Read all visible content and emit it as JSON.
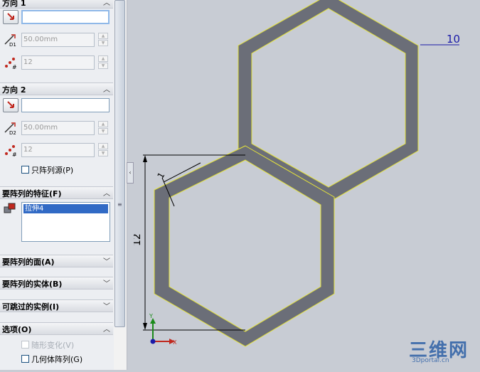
{
  "direction1": {
    "title": "方向 1",
    "spacing_value": "50.00mm",
    "count_value": "12"
  },
  "direction2": {
    "title": "方向 2",
    "spacing_value": "50.00mm",
    "count_value": "12",
    "pattern_seed_only_label": "只阵列源(P)"
  },
  "features_group": {
    "title": "要阵列的特征(F)",
    "items": [
      "拉伸4"
    ]
  },
  "faces_group": {
    "title": "要阵列的面(A)"
  },
  "bodies_group": {
    "title": "要阵列的实体(B)"
  },
  "skip_group": {
    "title": "可跳过的实例(I)"
  },
  "options_group": {
    "title": "选项(O)",
    "vary_sketch_label": "随形变化(V)",
    "geometry_pattern_label": "几何体阵列(G)"
  },
  "dimensions": {
    "offset": "10",
    "height": "12",
    "thickness": "1"
  },
  "triad": {
    "y": "Y",
    "x": "X"
  },
  "watermark": {
    "title": "三维网",
    "sub": "3Dportal.cn"
  },
  "colors": {
    "hex_fill": "#6b6e78",
    "hex_edge": "#e6e43a",
    "dim_color": "#1a1aa8",
    "background": "#c8ccd4"
  }
}
